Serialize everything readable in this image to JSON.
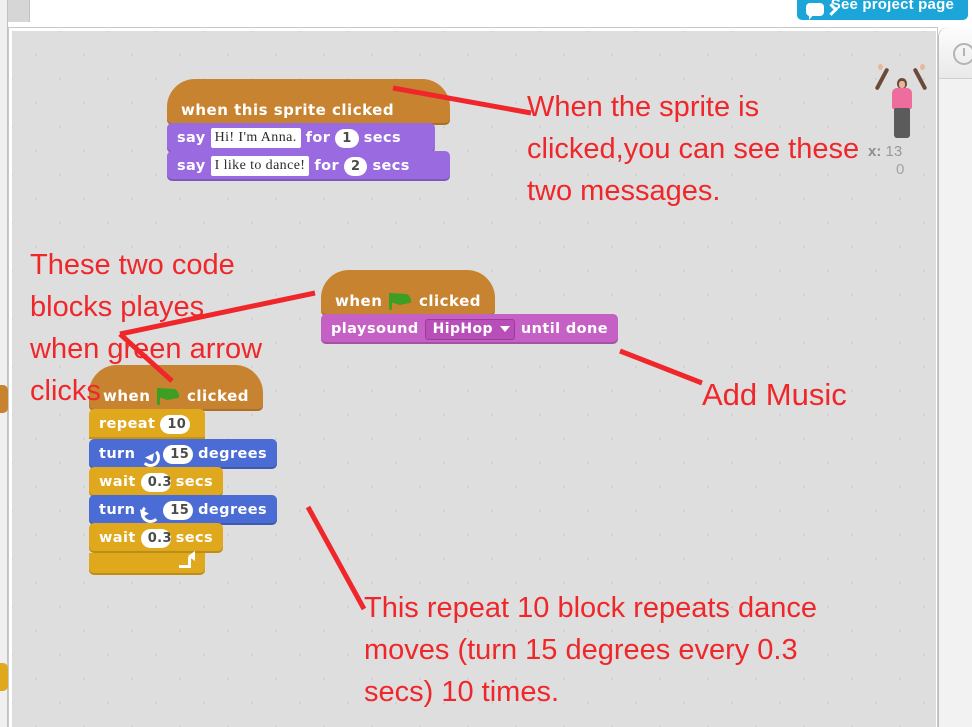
{
  "topbar": {
    "see_project_label": "See project page",
    "button_color": "#1ca5d8"
  },
  "stage_info": {
    "x_label": "x:",
    "x_value": "13",
    "y_value": "0"
  },
  "right_panel": {
    "tab_icon": "clock-icon"
  },
  "scripts": [
    {
      "id": "sprite-clicked-script",
      "hat": {
        "prefix": "when this sprite clicked"
      },
      "blocks": [
        {
          "type": "say-for-secs",
          "word_say": "say",
          "message": "Hi! I'm Anna.",
          "word_for": "for",
          "secs": "1",
          "word_secs": "secs"
        },
        {
          "type": "say-for-secs",
          "word_say": "say",
          "message": "I like to dance!",
          "word_for": "for",
          "secs": "2",
          "word_secs": "secs"
        }
      ]
    },
    {
      "id": "green-flag-sound-script",
      "hat": {
        "prefix": "when",
        "suffix": "clicked",
        "icon": "green-flag-icon"
      },
      "blocks": [
        {
          "type": "play-sound-until-done",
          "word_play": "play",
          "word_sound": "sound",
          "sound_name": "HipHop",
          "word_until_done": "until done"
        }
      ]
    },
    {
      "id": "green-flag-dance-script",
      "hat": {
        "prefix": "when",
        "suffix": "clicked",
        "icon": "green-flag-icon"
      },
      "repeat": {
        "word_repeat": "repeat",
        "times": "10",
        "body": [
          {
            "type": "turn-cw",
            "word_turn": "turn",
            "icon": "turn-clockwise-icon",
            "degrees": "15",
            "word_degrees": "degrees"
          },
          {
            "type": "wait",
            "word_wait": "wait",
            "secs": "0.3",
            "word_secs": "secs"
          },
          {
            "type": "turn-ccw",
            "word_turn": "turn",
            "icon": "turn-counterclockwise-icon",
            "degrees": "15",
            "word_degrees": "degrees"
          },
          {
            "type": "wait",
            "word_wait": "wait",
            "secs": "0.3",
            "word_secs": "secs"
          }
        ]
      }
    }
  ],
  "annotations": [
    {
      "id": "ann-sprite-clicked",
      "text": "When the sprite is\nclicked,you can see these\ntwo messages."
    },
    {
      "id": "ann-two-code-blocks",
      "text": "These two code\nblocks playes\nwhen green arrow\nclicks"
    },
    {
      "id": "ann-add-music",
      "text": "Add Music"
    },
    {
      "id": "ann-repeat-explain",
      "text": "This repeat 10 block repeats dance\nmoves (turn 15 degrees every 0.3\nsecs) 10 times."
    }
  ],
  "colors": {
    "annotation_red": "#f0272a",
    "events_block": "#c88330",
    "looks_block": "#9a6be0",
    "sound_block": "#c561c5",
    "motion_block": "#4a6cd4",
    "control_block": "#e0a81c",
    "canvas_bg": "#dedede"
  }
}
